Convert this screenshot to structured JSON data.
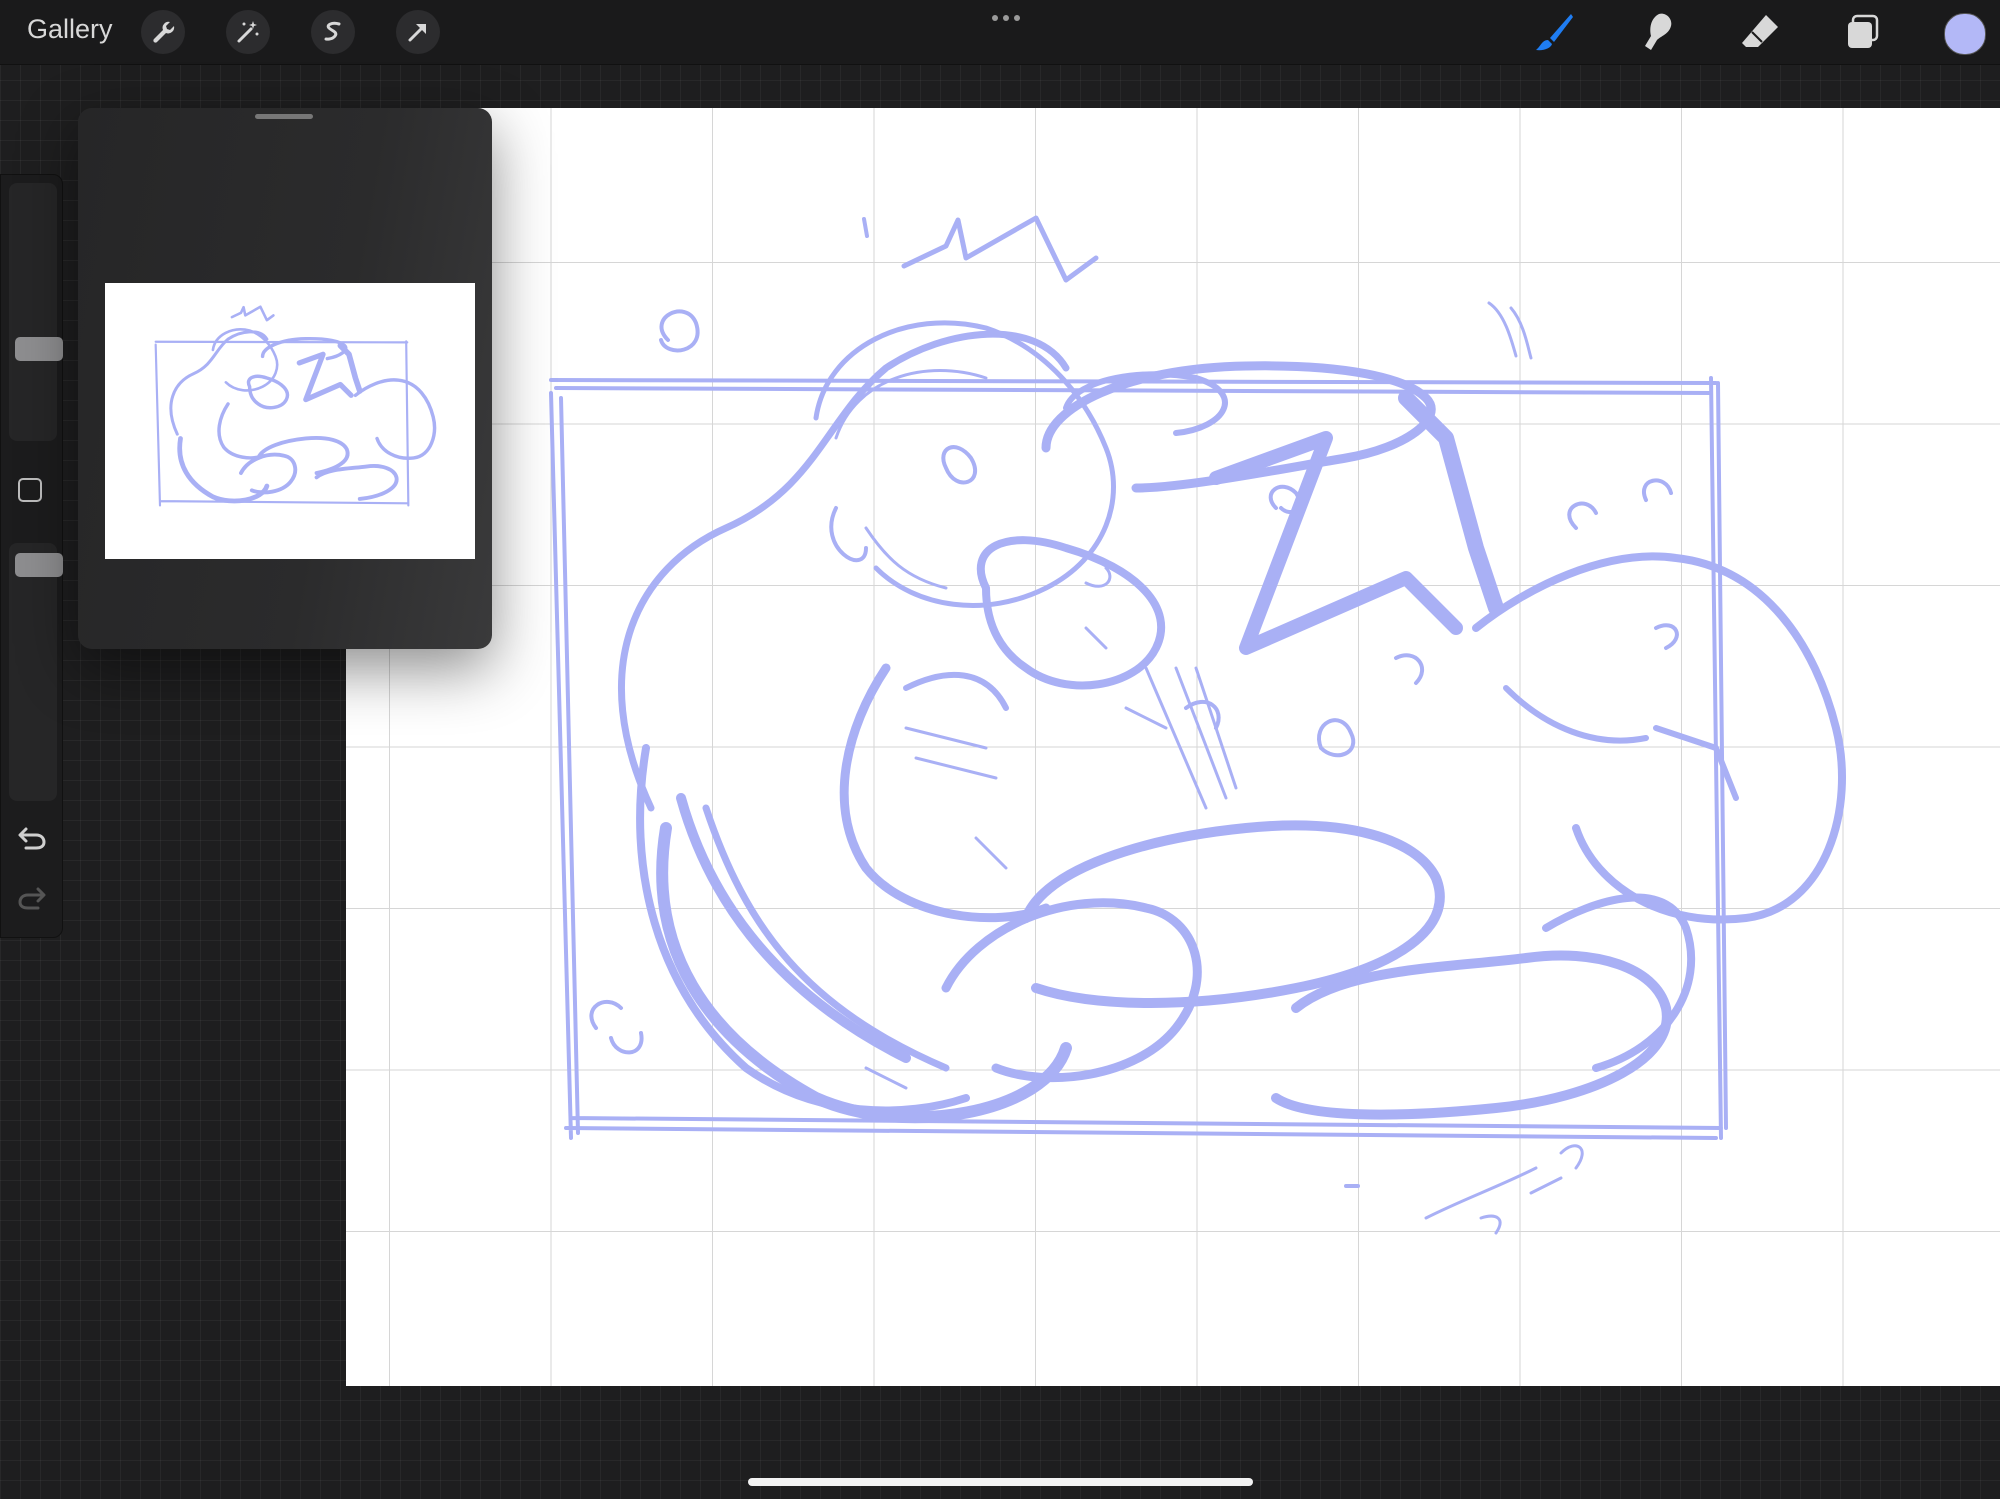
{
  "topbar": {
    "gallery_label": "Gallery",
    "left_tools": [
      "wrench-icon",
      "magic-wand-icon",
      "selection-icon",
      "transform-arrow-icon"
    ],
    "right_tools": [
      "brush-icon",
      "smudge-icon",
      "eraser-icon",
      "layers-icon"
    ],
    "active_tool": "brush",
    "current_color": "#b3b8f7",
    "accent_color": "#1f7df2"
  },
  "sidebar": {
    "brush_size_level": 0.6,
    "opacity_level": 0.92,
    "modify_button_icon": "square-icon",
    "undo_icon": "undo-icon",
    "redo_icon": "redo-icon"
  },
  "reference_panel": {
    "visible": true
  },
  "canvas": {
    "stroke_color": "#a9b0f5",
    "grid_visible": true
  }
}
